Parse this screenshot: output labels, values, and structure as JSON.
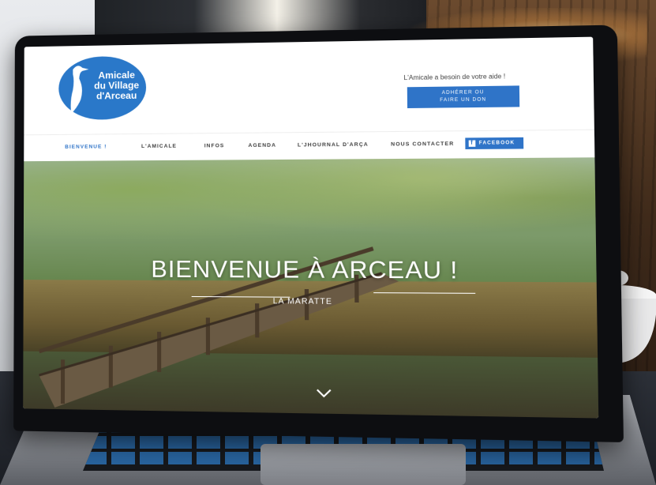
{
  "site": {
    "logo": {
      "line1": "Amicale",
      "line2": "du Village",
      "line3": "d'Arceau"
    },
    "help_text": "L'Amicale a besoin de votre aide !",
    "join_button": {
      "line1": "ADHÉRER OU",
      "line2": "FAIRE UN DON"
    },
    "nav": [
      {
        "label": "BIENVENUE !",
        "active": true
      },
      {
        "label": "L'AMICALE"
      },
      {
        "label": "INFOS"
      },
      {
        "label": "AGENDA"
      },
      {
        "label": "L'JHOURNAL D'ARÇA"
      },
      {
        "label": "NOUS CONTACTER"
      }
    ],
    "facebook_label": "FACEBOOK",
    "hero": {
      "title": "BIENVENUE À ARCEAU !",
      "subtitle": "LA MARATTE"
    }
  },
  "colors": {
    "brand_blue": "#2f74c8",
    "nav_text": "#3b3b3b"
  },
  "icons": [
    "heron-logo-icon",
    "facebook-icon",
    "chevron-down-icon"
  ]
}
